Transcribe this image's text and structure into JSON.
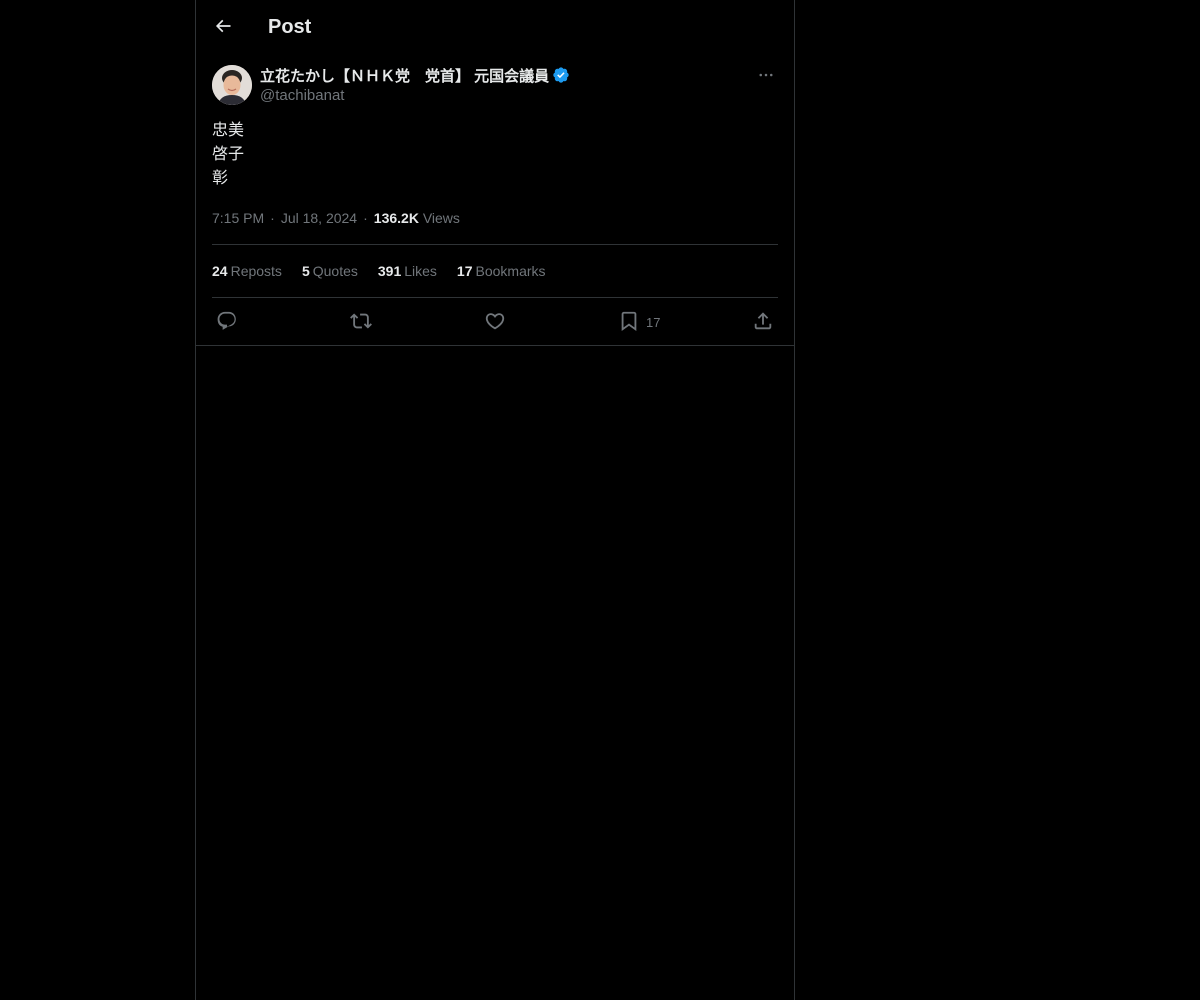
{
  "header": {
    "title": "Post"
  },
  "post": {
    "author": {
      "name": "立花たかし【ＮＨＫ党　党首】 元国会議員",
      "handle": "@tachibanat",
      "verified": true
    },
    "body_lines": [
      "忠美",
      "啓子",
      "彰"
    ],
    "time": "7:15 PM",
    "date": "Jul 18, 2024",
    "views_count": "136.2K",
    "views_label": "Views"
  },
  "stats": {
    "reposts": {
      "count": "24",
      "label": "Reposts"
    },
    "quotes": {
      "count": "5",
      "label": "Quotes"
    },
    "likes": {
      "count": "391",
      "label": "Likes"
    },
    "bookmarks": {
      "count": "17",
      "label": "Bookmarks"
    }
  },
  "actions": {
    "reply_icon": "reply-icon",
    "repost_icon": "repost-icon",
    "like_icon": "heart-icon",
    "bookmark_icon": "bookmark-icon",
    "bookmark_count": "17",
    "share_icon": "share-icon"
  },
  "colors": {
    "background": "#000000",
    "text": "#e7e9ea",
    "muted": "#71767b",
    "border": "#2f3336",
    "verified": "#1d9bf0"
  }
}
